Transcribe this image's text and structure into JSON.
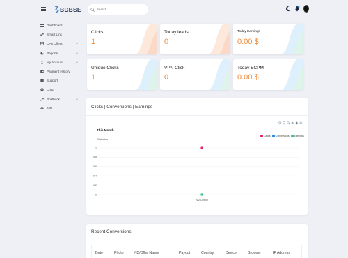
{
  "header": {
    "logo_text": "BDBSE",
    "search_placeholder": "Search..."
  },
  "sidebar": {
    "items": [
      {
        "label": "Dashboard",
        "icon": "grid-icon",
        "has_submenu": false
      },
      {
        "label": "Smart Link",
        "icon": "link-icon",
        "has_submenu": false
      },
      {
        "label": "CPA Offers",
        "icon": "table-icon",
        "has_submenu": true
      },
      {
        "label": "Reports",
        "icon": "chart-pie-icon",
        "has_submenu": true
      },
      {
        "label": "My Account",
        "icon": "user-icon",
        "has_submenu": true
      },
      {
        "label": "Payment History",
        "icon": "wallet-icon",
        "has_submenu": false
      },
      {
        "label": "Support",
        "icon": "ticket-icon",
        "has_submenu": false
      },
      {
        "label": "Chat",
        "icon": "chat-icon",
        "has_submenu": false
      },
      {
        "label": "Postback",
        "icon": "postback-icon",
        "has_submenu": true
      },
      {
        "label": "API",
        "icon": "api-icon",
        "has_submenu": false
      }
    ]
  },
  "stats": [
    {
      "title": "Clicks",
      "value": "1",
      "small": false
    },
    {
      "title": "Today leads",
      "value": "0",
      "small": false
    },
    {
      "title": "Today Earnings",
      "value": "0.00 $",
      "small": true
    },
    {
      "title": "Unique Clicks",
      "value": "1",
      "small": false
    },
    {
      "title": "VPN Click",
      "value": "0",
      "small": false
    },
    {
      "title": "Today ECPM",
      "value": "0.00 $",
      "small": false
    }
  ],
  "chart_section": {
    "card_title": "Clicks | Conversions | Earnings"
  },
  "colors": {
    "accent_value": "#f08a3a",
    "clicks": "#e91e63",
    "conversions": "#1e88e5",
    "earnings": "#2ecc71"
  },
  "chart_data": {
    "type": "line",
    "title": "This Month",
    "subtitle": "Statistics",
    "x": [
      "2025-09-02"
    ],
    "series": [
      {
        "name": "Clicks",
        "values": [
          1
        ]
      },
      {
        "name": "Conversions",
        "values": [
          0
        ]
      },
      {
        "name": "Earnings",
        "values": [
          0
        ]
      }
    ],
    "ylim": [
      0,
      1
    ],
    "yticks": [
      "1",
      "0.8",
      "0.6",
      "0.4",
      "0.2",
      "0"
    ],
    "legend_position": "top-right",
    "grid": true
  },
  "conversions": {
    "title": "Recent Conversions",
    "columns": [
      "Date",
      "Photo",
      "#ID/Offer Name",
      "Payout",
      "Country",
      "Device",
      "Browser",
      "IP Address"
    ]
  }
}
